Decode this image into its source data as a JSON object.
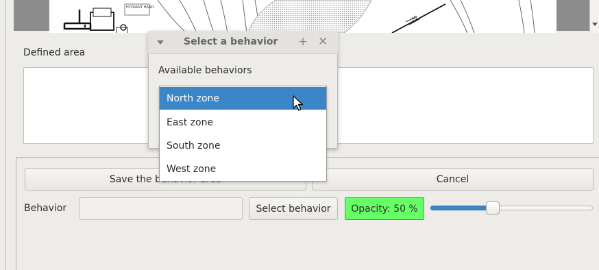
{
  "map": {
    "label_fragment_1": "HYDRANT HAND",
    "label_fragment_2": "AS"
  },
  "defined_area": {
    "label": "Defined area"
  },
  "buttons": {
    "save_label": "Save the behavior area",
    "cancel_label": "Cancel",
    "select_behavior_label": "Select behavior"
  },
  "behavior": {
    "label": "Behavior",
    "value": ""
  },
  "opacity": {
    "label": "Opacity: 50 %",
    "value_percent": 50,
    "badge_color": "#66ff66"
  },
  "dialog": {
    "title": "Select a behavior",
    "plus_glyph": "+",
    "close_glyph": "✕",
    "available_label": "Available behaviors",
    "items": [
      {
        "label": "North zone",
        "selected": true
      },
      {
        "label": "East zone",
        "selected": false
      },
      {
        "label": "South zone",
        "selected": false
      },
      {
        "label": "West zone",
        "selected": false
      }
    ]
  },
  "colors": {
    "selection": "#3a86c8",
    "window_bg": "#eeece8"
  }
}
